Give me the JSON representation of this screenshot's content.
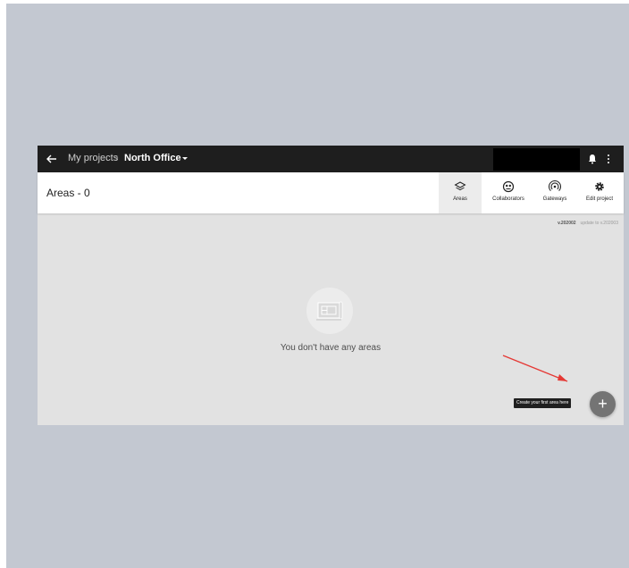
{
  "topbar": {
    "breadcrumb_root": "My projects",
    "breadcrumb_separator": "›",
    "breadcrumb_current": "North Office"
  },
  "header": {
    "areas_count": "Areas - 0",
    "tabs": [
      {
        "label": "Areas",
        "icon": "layers-icon",
        "active": true
      },
      {
        "label": "Collaborators",
        "icon": "collaborators-icon",
        "active": false
      },
      {
        "label": "Gateways",
        "icon": "gateway-signal-icon",
        "active": false
      },
      {
        "label": "Edit project",
        "icon": "gear-icon",
        "active": false
      }
    ]
  },
  "version": {
    "current": "v.202002",
    "update": "update to v.202003"
  },
  "empty_state": {
    "message": "You don't have any areas",
    "icon": "floorplan-icon"
  },
  "fab": {
    "tooltip": "Create your first area here",
    "label": "+"
  },
  "colors": {
    "topbar": "#1e1e1e",
    "content_bg": "#e2e2e2",
    "backdrop": "#c3c8d1",
    "annotation_arrow": "#e53935"
  }
}
